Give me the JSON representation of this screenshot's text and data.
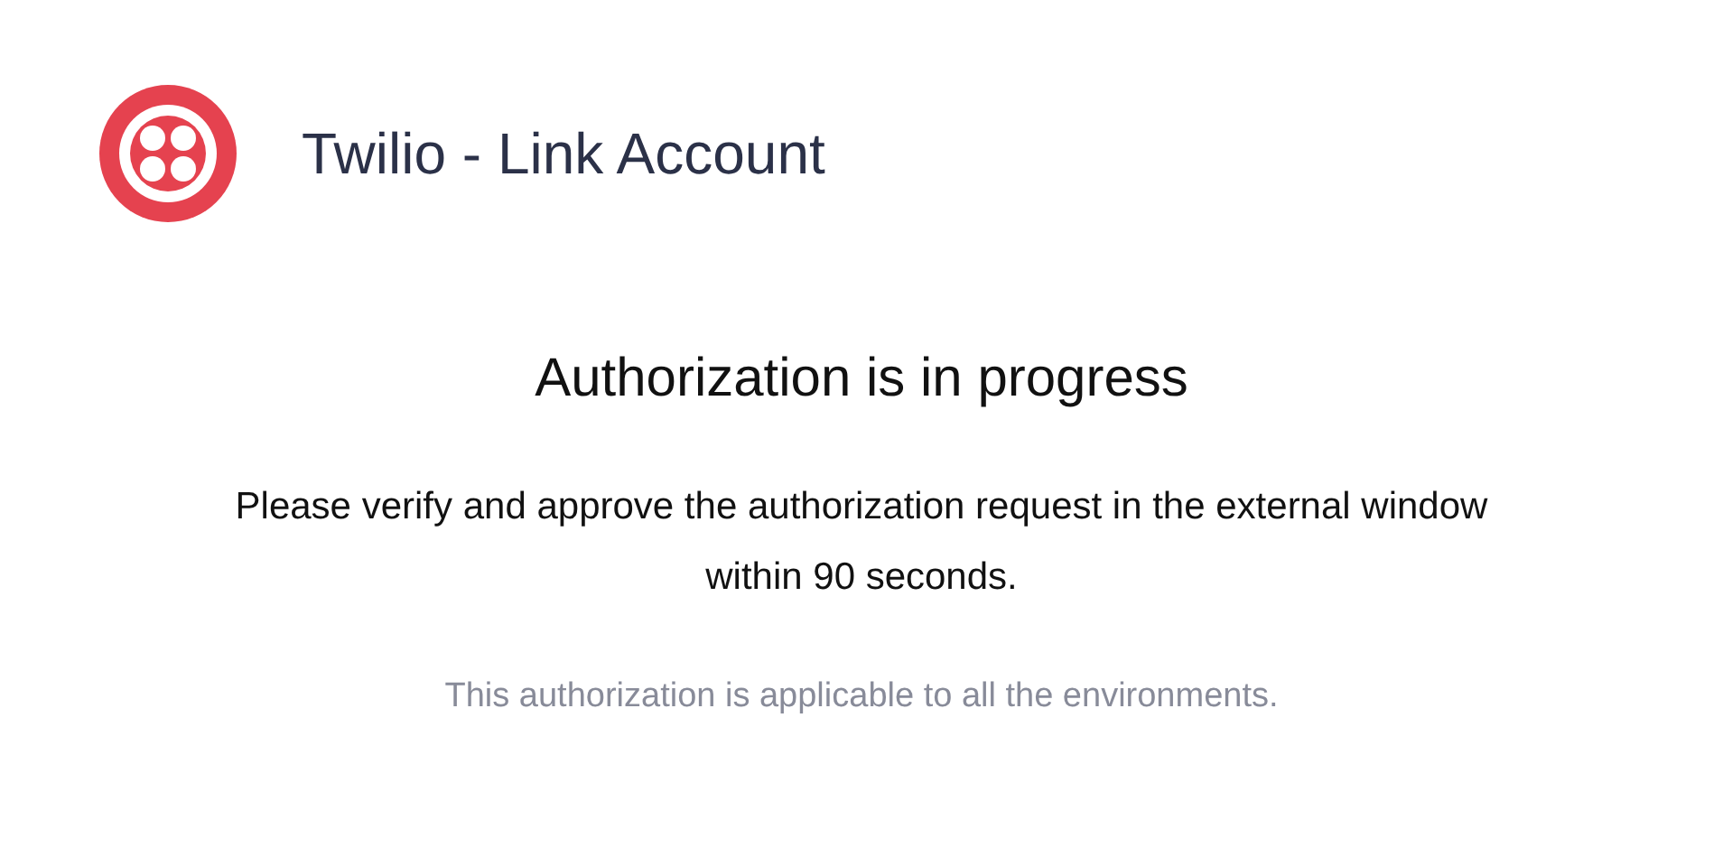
{
  "header": {
    "title": "Twilio - Link Account"
  },
  "status": {
    "heading": "Authorization is in progress",
    "message": "Please verify and approve the authorization request in the external window within 90 seconds.",
    "note": "This authorization is applicable to all the environments."
  }
}
